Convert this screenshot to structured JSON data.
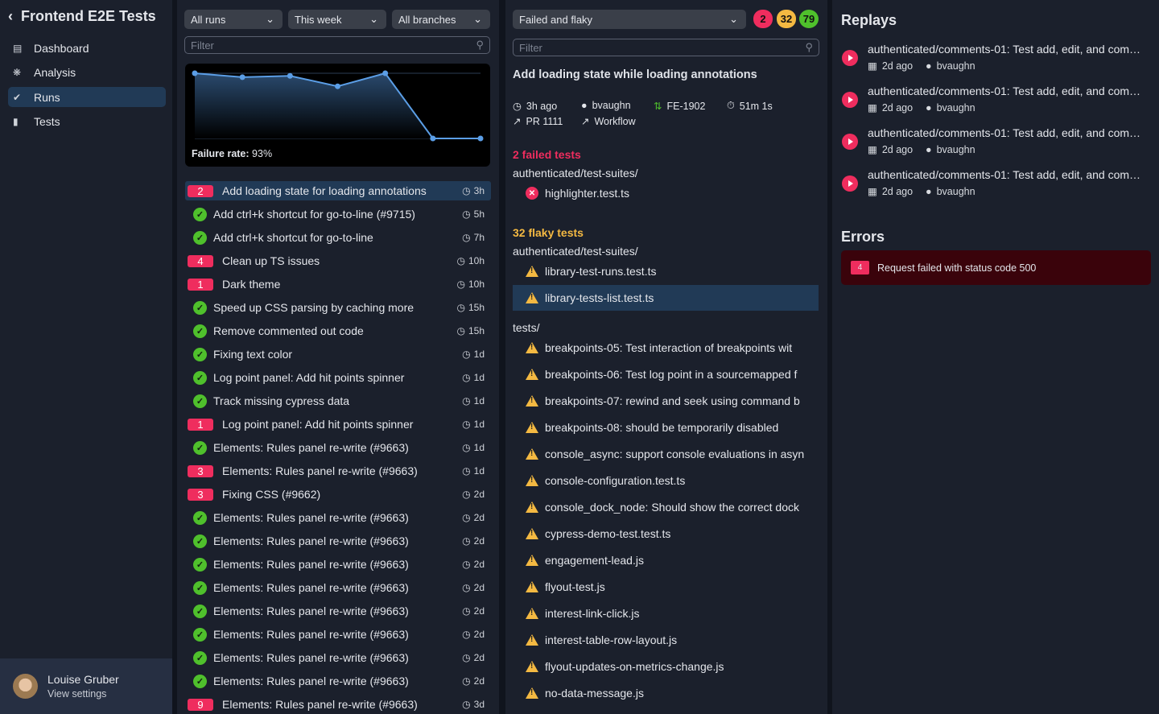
{
  "sidebar": {
    "title": "Frontend E2E Tests",
    "nav": [
      {
        "label": "Dashboard",
        "icon": "dashboard-icon"
      },
      {
        "label": "Analysis",
        "icon": "analysis-icon"
      },
      {
        "label": "Runs",
        "icon": "runs-icon",
        "active": true
      },
      {
        "label": "Tests",
        "icon": "tests-icon"
      }
    ],
    "user": {
      "name": "Louise Gruber",
      "link": "View settings"
    }
  },
  "runs": {
    "filters": [
      "All runs",
      "This week",
      "All branches"
    ],
    "filter_placeholder": "Filter",
    "chart_label": "Failure rate:",
    "chart_value": "93%",
    "items": [
      {
        "label": "Add loading state for loading annotations",
        "time": "3h",
        "failures": "2",
        "active": true
      },
      {
        "label": "Add ctrl+k shortcut for go-to-line (#9715)",
        "time": "5h"
      },
      {
        "label": "Add ctrl+k shortcut for go-to-line",
        "time": "7h"
      },
      {
        "label": "Clean up TS issues",
        "time": "10h",
        "failures": "4"
      },
      {
        "label": "Dark theme",
        "time": "10h",
        "failures": "1"
      },
      {
        "label": "Speed up CSS parsing by caching more",
        "time": "15h"
      },
      {
        "label": "Remove commented out code",
        "time": "15h"
      },
      {
        "label": "Fixing text color",
        "time": "1d"
      },
      {
        "label": "Log point panel: Add hit points spinner",
        "time": "1d"
      },
      {
        "label": "Track missing cypress data",
        "time": "1d"
      },
      {
        "label": "Log point panel: Add hit points spinner",
        "time": "1d",
        "failures": "1"
      },
      {
        "label": "Elements: Rules panel re-write (#9663)",
        "time": "1d"
      },
      {
        "label": "Elements: Rules panel re-write (#9663)",
        "time": "1d",
        "failures": "3"
      },
      {
        "label": "Fixing CSS (#9662)",
        "time": "2d",
        "failures": "3"
      },
      {
        "label": "Elements: Rules panel re-write (#9663)",
        "time": "2d"
      },
      {
        "label": "Elements: Rules panel re-write (#9663)",
        "time": "2d"
      },
      {
        "label": "Elements: Rules panel re-write (#9663)",
        "time": "2d"
      },
      {
        "label": "Elements: Rules panel re-write (#9663)",
        "time": "2d"
      },
      {
        "label": "Elements: Rules panel re-write (#9663)",
        "time": "2d"
      },
      {
        "label": "Elements: Rules panel re-write (#9663)",
        "time": "2d"
      },
      {
        "label": "Elements: Rules panel re-write (#9663)",
        "time": "2d"
      },
      {
        "label": "Elements: Rules panel re-write (#9663)",
        "time": "2d"
      },
      {
        "label": "Elements: Rules panel re-write (#9663)",
        "time": "3d",
        "failures": "9"
      }
    ]
  },
  "chart_data": {
    "type": "area",
    "title": "Failure rate",
    "y": [
      100,
      94,
      96,
      80,
      100,
      0,
      0
    ],
    "ylim": [
      0,
      100
    ]
  },
  "detail": {
    "filter": "Failed and flaky",
    "counts": {
      "failed": "2",
      "flaky": "32",
      "passed": "79"
    },
    "filter_placeholder": "Filter",
    "title": "Add loading state while loading annotations",
    "meta": {
      "time": "3h ago",
      "user": "bvaughn",
      "branch": "FE-1902",
      "duration": "51m 1s",
      "pr": "PR 1111",
      "workflow": "Workflow"
    },
    "failed_heading": "2 failed tests",
    "failed_path": "authenticated/test-suites/",
    "failed": [
      "highlighter.test.ts"
    ],
    "flaky_heading": "32 flaky tests",
    "flaky_path": "authenticated/test-suites/",
    "flaky": [
      "library-test-runs.test.ts",
      "library-tests-list.test.ts"
    ],
    "tests_path": "tests/",
    "tests": [
      "breakpoints-05: Test interaction of breakpoints wit",
      "breakpoints-06: Test log point in a sourcemapped f",
      "breakpoints-07: rewind and seek using command b",
      "breakpoints-08: should be temporarily disabled",
      "console_async: support console evaluations in asyn",
      "console-configuration.test.ts",
      "console_dock_node: Should show the correct dock",
      "cypress-demo-test.test.ts",
      "engagement-lead.js",
      "flyout-test.js",
      "interest-link-click.js",
      "interest-table-row-layout.js",
      "flyout-updates-on-metrics-change.js",
      "no-data-message.js"
    ]
  },
  "right": {
    "replays_title": "Replays",
    "replays": [
      {
        "title": "authenticated/comments-01: Test add, edit, and com…",
        "date": "2d ago",
        "user": "bvaughn"
      },
      {
        "title": "authenticated/comments-01: Test add, edit, and com…",
        "date": "2d ago",
        "user": "bvaughn"
      },
      {
        "title": "authenticated/comments-01: Test add, edit, and com…",
        "date": "2d ago",
        "user": "bvaughn"
      },
      {
        "title": "authenticated/comments-01: Test add, edit, and com…",
        "date": "2d ago",
        "user": "bvaughn"
      }
    ],
    "errors_title": "Errors",
    "errors": [
      {
        "count": "4",
        "message": "Request failed with status code 500"
      }
    ]
  },
  "colors": {
    "failed": "#ef2d5e",
    "flaky": "#f4b942",
    "passed": "#4fc02c",
    "accent": "#213a56"
  }
}
